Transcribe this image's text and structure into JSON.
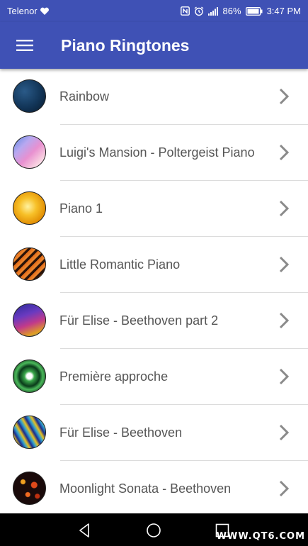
{
  "status_bar": {
    "carrier": "Telenor",
    "battery": "86%",
    "time": "3:47 PM",
    "icons": [
      "heart-icon",
      "nfc-icon",
      "alarm-icon",
      "signal-icon",
      "battery-icon"
    ]
  },
  "app_bar": {
    "title": "Piano Ringtones",
    "background": "#3f51b5",
    "menu_icon": "hamburger-menu-icon"
  },
  "ringtones": [
    {
      "label": "Rainbow",
      "thumb_colors": [
        "#0f2a44",
        "#234f78",
        "#0a1c30"
      ]
    },
    {
      "label": "Luigi's Mansion - Poltergeist Piano",
      "thumb_colors": [
        "#7aa6e8",
        "#d88ad2",
        "#f4c0d8"
      ]
    },
    {
      "label": "Piano 1",
      "thumb_colors": [
        "#f7b21a",
        "#ffe070",
        "#c86a00"
      ]
    },
    {
      "label": "Little Romantic Piano",
      "thumb_colors": [
        "#d85a10",
        "#2a1208",
        "#f08a30"
      ]
    },
    {
      "label": "Für Elise - Beethoven part 2",
      "thumb_colors": [
        "#3a2a9a",
        "#c23a8a",
        "#e0a020"
      ]
    },
    {
      "label": "Première approche",
      "thumb_colors": [
        "#0a3a1a",
        "#4ab85a",
        "#f0f0f0"
      ]
    },
    {
      "label": "Für Elise - Beethoven",
      "thumb_colors": [
        "#1a2a8a",
        "#e8c020",
        "#30a0d0"
      ]
    },
    {
      "label": "Moonlight Sonata - Beethoven",
      "thumb_colors": [
        "#1a0a0a",
        "#e04a1a",
        "#f0a020"
      ]
    }
  ],
  "nav_bar": {
    "icons": [
      "back-icon",
      "home-icon",
      "recents-icon"
    ]
  },
  "watermark": "WWW.QT6.COM"
}
